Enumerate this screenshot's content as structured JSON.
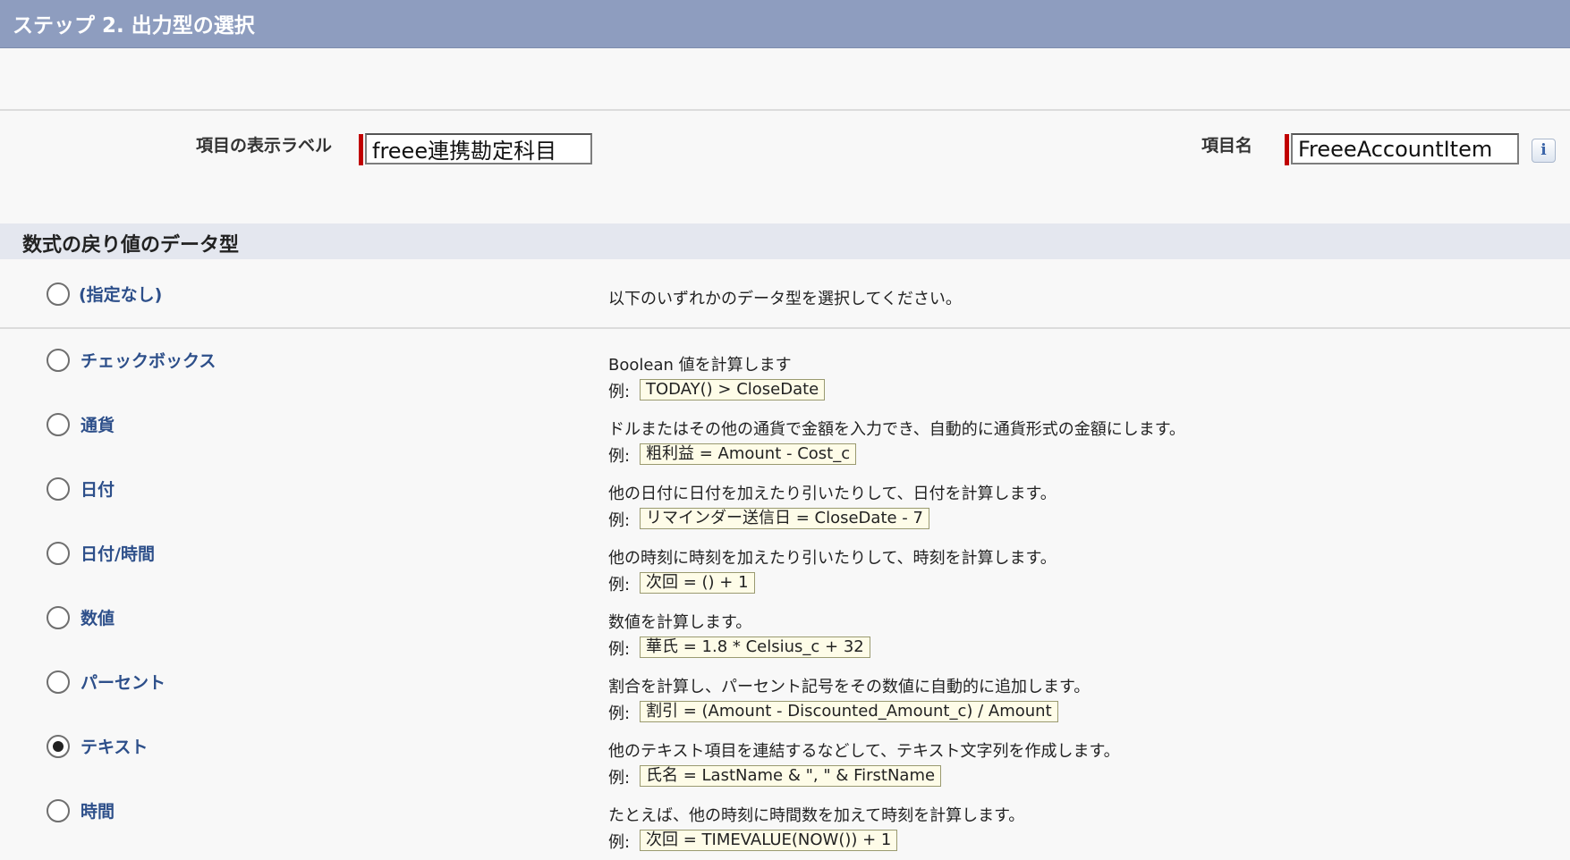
{
  "header": {
    "title": "ステップ 2. 出力型の選択"
  },
  "fields": {
    "display_label": {
      "label": "項目の表示ラベル",
      "value": "freee連携勘定科目"
    },
    "api_name": {
      "label": "項目名",
      "value": "FreeeAccountItem"
    },
    "info_icon": "i"
  },
  "section": {
    "title": "数式の戻り値のデータ型"
  },
  "return_types": [
    {
      "label": "(指定なし)",
      "description": "以下のいずれかのデータ型を選択してください。",
      "example_prefix": "",
      "example": "",
      "selected": false
    },
    {
      "label": "チェックボックス",
      "description": "Boolean 値を計算します",
      "example_prefix": "例:",
      "example": "TODAY() > CloseDate",
      "selected": false
    },
    {
      "label": "通貨",
      "description": "ドルまたはその他の通貨で金額を入力でき、自動的に通貨形式の金額にします。",
      "example_prefix": "例:",
      "example": "粗利益 = Amount - Cost_c",
      "selected": false
    },
    {
      "label": "日付",
      "description": "他の日付に日付を加えたり引いたりして、日付を計算します。",
      "example_prefix": "例:",
      "example": "リマインダー送信日 = CloseDate - 7",
      "selected": false
    },
    {
      "label": "日付/時間",
      "description": "他の時刻に時刻を加えたり引いたりして、時刻を計算します。",
      "example_prefix": "例:",
      "example": "次回 = () + 1",
      "selected": false
    },
    {
      "label": "数値",
      "description": "数値を計算します。",
      "example_prefix": "例:",
      "example": "華氏 = 1.8 * Celsius_c + 32",
      "selected": false
    },
    {
      "label": "パーセント",
      "description": "割合を計算し、パーセント記号をその数値に自動的に追加します。",
      "example_prefix": "例:",
      "example": "割引 = (Amount - Discounted_Amount_c) / Amount",
      "selected": false
    },
    {
      "label": "テキスト",
      "description": "他のテキスト項目を連結するなどして、テキスト文字列を作成します。",
      "example_prefix": "例:",
      "example": "氏名 = LastName & \", \" & FirstName",
      "selected": true
    },
    {
      "label": "時間",
      "description": "たとえば、他の時刻に時間数を加えて時刻を計算します。",
      "example_prefix": "例:",
      "example": "次回 = TIMEVALUE(NOW()) + 1",
      "selected": false
    }
  ]
}
